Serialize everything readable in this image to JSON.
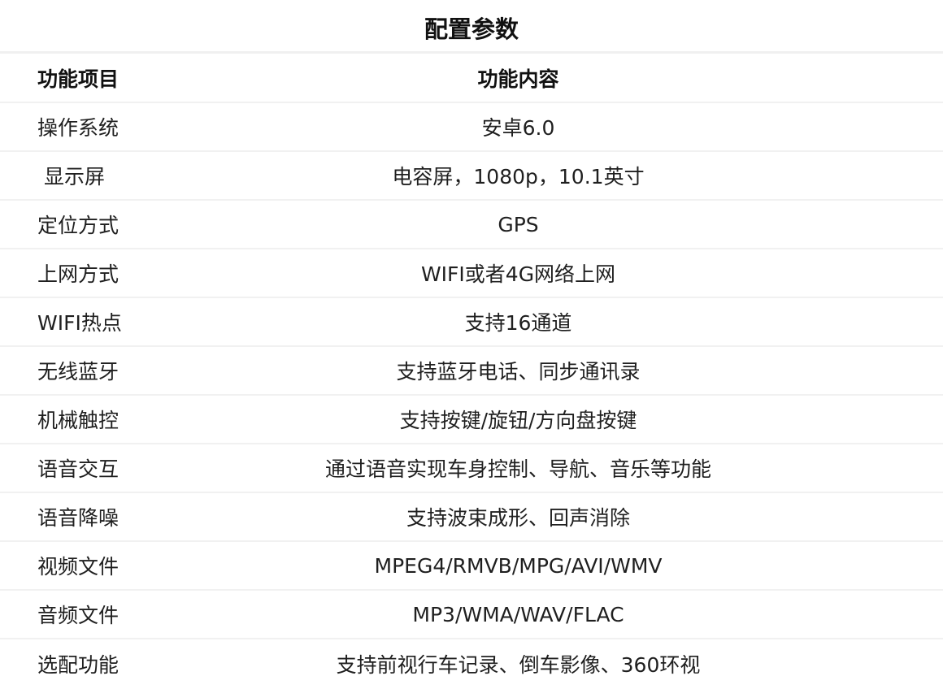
{
  "title": "配置参数",
  "header": {
    "name": "功能项目",
    "value": "功能内容"
  },
  "rows": [
    {
      "name": "操作系统",
      "value": "安卓6.0"
    },
    {
      "name": " 显示屏",
      "value": "电容屏，1080p，10.1英寸"
    },
    {
      "name": "定位方式",
      "value": "GPS"
    },
    {
      "name": "上网方式",
      "value": "WIFI或者4G网络上网"
    },
    {
      "name": "WIFI热点",
      "value": "支持16通道"
    },
    {
      "name": "无线蓝牙",
      "value": "支持蓝牙电话、同步通讯录"
    },
    {
      "name": "机械触控",
      "value": "支持按键/旋钮/方向盘按键"
    },
    {
      "name": "语音交互",
      "value": "通过语音实现车身控制、导航、音乐等功能"
    },
    {
      "name": "语音降噪",
      "value": "支持波束成形、回声消除"
    },
    {
      "name": "视频文件",
      "value": "MPEG4/RMVB/MPG/AVI/WMV"
    },
    {
      "name": "音频文件",
      "value": "MP3/WMA/WAV/FLAC"
    },
    {
      "name": "选配功能",
      "value": "支持前视行车记录、倒车影像、360环视"
    }
  ]
}
